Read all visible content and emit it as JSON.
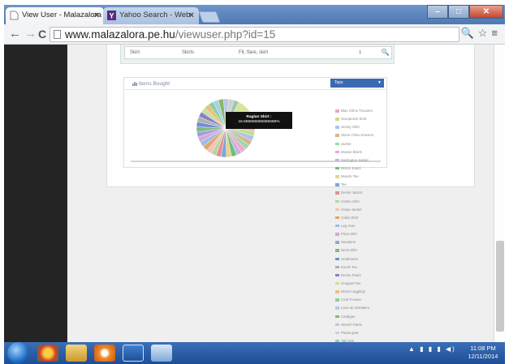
{
  "browser": {
    "tabs": [
      {
        "title": "View User - Malazalora",
        "active": true
      },
      {
        "title": "Yahoo Search - Web Sear",
        "active": false
      }
    ],
    "url_host": "www.malazalora.pe.hu",
    "url_path": "/viewuser.php?id=15",
    "nav": {
      "back": "←",
      "forward": "→",
      "reload": "C"
    },
    "toolbar_right": "🔍☆≡"
  },
  "order_row": {
    "col1": "Skirt",
    "col2": "Skirts",
    "col3": "Fit, flare, skirt",
    "qty": "1",
    "search_glyph": "🔍"
  },
  "panel": {
    "title": "Items Bought",
    "title_icon": "bar-chart-icon",
    "select_value": "Tops",
    "caret": "▼"
  },
  "tooltip": {
    "label": "Raglan Shirt :",
    "value": "16.666666666666668%"
  },
  "chart_data": {
    "type": "pie",
    "title": "",
    "highlighted": "Raglan Shirt",
    "legend_visible": [
      "Blue Chino Trousers",
      "Scoopneck Shirt",
      "Jersey Shirt",
      "Stone Chino trousers",
      "Jacket",
      "Mossie Briefs",
      "Harrington Jacket",
      "Bristol Jeans",
      "Muscle Tee",
      "Tee",
      "Denim Jacket",
      "Cotton Shirt",
      "Crepe Jacket",
      "Collar Shirt",
      "Leg Jean",
      "Pima Shirt",
      "Sneakers",
      "Neck Shirt",
      "Underwear",
      "Knock Tee",
      "Denim Pants",
      "Cropped Tee",
      "Dress Leggings",
      "Cord Trouser",
      "Lace-up Sneakers",
      "Cardigan",
      "Stretch Pants",
      "Pleats gear",
      "Tab Ons"
    ],
    "legend_colors": [
      "#e9a6c6",
      "#c9dc88",
      "#a9c4ec",
      "#d5b58f",
      "#9fd8a4",
      "#f0a9d2",
      "#c7b2e0",
      "#6cbf78",
      "#e7d48a",
      "#7aa6e0",
      "#e58f8f",
      "#b6d89a",
      "#f4c0c0",
      "#e0a866",
      "#9bbde8",
      "#d9a6d8",
      "#a0a0d8",
      "#7fb88a",
      "#6f8fd0",
      "#b0b0b0",
      "#8a7fc8",
      "#c8e0a0",
      "#e8c080",
      "#8fcf9f",
      "#a8d0e8",
      "#88b868",
      "#b8c8e8",
      "#d0d0d0",
      "#9fc8b0"
    ],
    "series": [
      {
        "label": "Raglan Shirt",
        "value": 16.67,
        "color": "#d4e69a"
      },
      {
        "label": "Blue Chino Trousers",
        "value": 3.0,
        "color": "#e9a6c6"
      },
      {
        "label": "Scoopneck Shirt",
        "value": 3.0,
        "color": "#c9dc88"
      },
      {
        "label": "Jersey Shirt",
        "value": 3.0,
        "color": "#a9c4ec"
      },
      {
        "label": "Stone Chino trousers",
        "value": 3.0,
        "color": "#d5b58f"
      },
      {
        "label": "Jacket",
        "value": 3.0,
        "color": "#9fd8a4"
      },
      {
        "label": "Mossie Briefs",
        "value": 3.0,
        "color": "#f0a9d2"
      },
      {
        "label": "Harrington Jacket",
        "value": 3.0,
        "color": "#c7b2e0"
      },
      {
        "label": "Bristol Jeans",
        "value": 3.0,
        "color": "#6cbf78"
      },
      {
        "label": "Muscle Tee",
        "value": 3.0,
        "color": "#e7d48a"
      },
      {
        "label": "Tee",
        "value": 3.0,
        "color": "#7aa6e0"
      },
      {
        "label": "Denim Jacket",
        "value": 3.0,
        "color": "#e58f8f"
      },
      {
        "label": "Cotton Shirt",
        "value": 3.0,
        "color": "#b6d89a"
      },
      {
        "label": "Crepe Jacket",
        "value": 3.0,
        "color": "#f4c0c0"
      },
      {
        "label": "Collar Shirt",
        "value": 3.0,
        "color": "#e0a866"
      },
      {
        "label": "Leg Jean",
        "value": 3.0,
        "color": "#9bbde8"
      },
      {
        "label": "Pima Shirt",
        "value": 3.0,
        "color": "#d9a6d8"
      },
      {
        "label": "Sneakers",
        "value": 3.0,
        "color": "#a0a0d8"
      },
      {
        "label": "Neck Shirt",
        "value": 3.0,
        "color": "#7fb88a"
      },
      {
        "label": "Underwear",
        "value": 3.0,
        "color": "#6f8fd0"
      },
      {
        "label": "Knock Tee",
        "value": 3.0,
        "color": "#b0b0b0"
      },
      {
        "label": "Denim Pants",
        "value": 3.0,
        "color": "#8a7fc8"
      },
      {
        "label": "Cropped Tee",
        "value": 3.0,
        "color": "#c8e0a0"
      },
      {
        "label": "Dress Leggings",
        "value": 3.0,
        "color": "#e8c080"
      },
      {
        "label": "Cord Trouser",
        "value": 3.0,
        "color": "#8fcf9f"
      },
      {
        "label": "Lace-up Sneakers",
        "value": 3.0,
        "color": "#a8d0e8"
      },
      {
        "label": "Cardigan",
        "value": 3.0,
        "color": "#88b868"
      },
      {
        "label": "Stretch Pants",
        "value": 3.0,
        "color": "#b8c8e8"
      },
      {
        "label": "Pleats gear",
        "value": 3.0,
        "color": "#d0d0d0"
      },
      {
        "label": "Tab Ons",
        "value": 3.0,
        "color": "#9fc8b0"
      }
    ]
  },
  "side_button_glyph": "▲",
  "taskbar": {
    "tray_icons": "▲ ▮ ▮ ▮ ◀)",
    "time": "11:08 PM",
    "date": "12/11/2014"
  }
}
